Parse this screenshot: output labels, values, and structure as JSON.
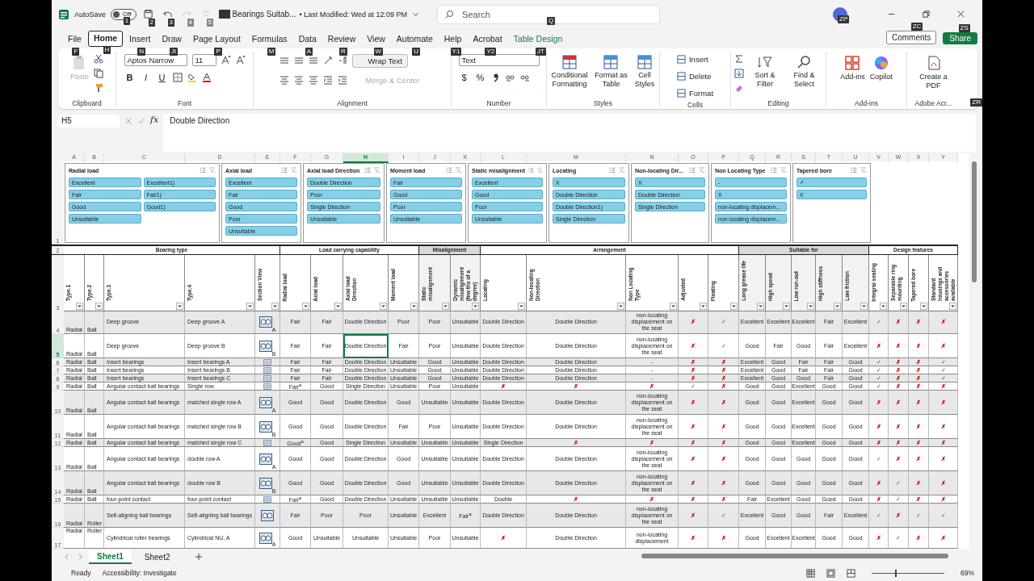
{
  "title_bar": {
    "autosave_label": "AutoSave",
    "autosave": {
      "on": false,
      "label": "Off",
      "keytip": "1"
    },
    "quick_access": [
      {
        "kind": "save",
        "keytip": "2",
        "disabled": false
      },
      {
        "kind": "undo",
        "keytip": "3",
        "disabled": false
      },
      {
        "kind": "redo",
        "keytip": "4",
        "disabled": true
      },
      {
        "kind": "customize",
        "keytip": "5",
        "disabled": true
      }
    ],
    "file_name": "Bearings Suitab...",
    "last_modified": "• Last Modified: Wed at 12:09 PM",
    "search_placeholder": "Search",
    "search_keytip": "Q",
    "avatar_keytip": "ZP"
  },
  "tabs": [
    {
      "label": "File",
      "keytip": "F",
      "selected": false,
      "contextual": false
    },
    {
      "label": "Home",
      "keytip": "H",
      "selected": true,
      "contextual": false
    },
    {
      "label": "Insert",
      "keytip": "N",
      "selected": false,
      "contextual": false
    },
    {
      "label": "Draw",
      "keytip": "JI",
      "selected": false,
      "contextual": false
    },
    {
      "label": "Page Layout",
      "keytip": "P",
      "selected": false,
      "contextual": false
    },
    {
      "label": "Formulas",
      "keytip": "M",
      "selected": false,
      "contextual": false
    },
    {
      "label": "Data",
      "keytip": "A",
      "selected": false,
      "contextual": false
    },
    {
      "label": "Review",
      "keytip": "R",
      "selected": false,
      "contextual": false
    },
    {
      "label": "View",
      "keytip": "W",
      "selected": false,
      "contextual": false
    },
    {
      "label": "Automate",
      "keytip": "U",
      "selected": false,
      "contextual": false
    },
    {
      "label": "Help",
      "keytip": "Y1",
      "selected": false,
      "contextual": false
    },
    {
      "label": "Acrobat",
      "keytip": "Y2",
      "selected": false,
      "contextual": false
    },
    {
      "label": "Table Design",
      "keytip": "JT",
      "selected": false,
      "contextual": true
    }
  ],
  "comments": {
    "label": "Comments",
    "keytip": "ZC"
  },
  "share": {
    "label": "Share",
    "keytip": "ZS"
  },
  "ribbon_keytip": "ZR",
  "ribbon": {
    "clipboard": {
      "label": "Clipboard",
      "paste": "Paste"
    },
    "font": {
      "label": "Font",
      "name": "Aptos Narrow",
      "size": "11",
      "bold": "B",
      "italic": "I",
      "underline": "U"
    },
    "alignment": {
      "label": "Alignment",
      "wrap_text": "Wrap Text",
      "merge": "Merge & Center"
    },
    "number": {
      "label": "Number",
      "format": "Text",
      "currency": "$",
      "percent": "%"
    },
    "styles": {
      "label": "Styles",
      "buttons": [
        "Conditional Formatting",
        "Format as Table",
        "Cell Styles"
      ]
    },
    "cells": {
      "label": "Cells",
      "buttons": [
        "Insert",
        "Delete",
        "Format"
      ]
    },
    "editing": {
      "label": "Editing",
      "buttons": [
        "Sort & Filter",
        "Find & Select"
      ]
    },
    "addins": {
      "label": "Add-ins",
      "buttons": [
        "Add-ins",
        "Copilot"
      ]
    },
    "acrobat": {
      "label": "Adobe Acr...",
      "buttons": [
        "Create a PDF"
      ]
    }
  },
  "formula_bar": {
    "name_box": "H5",
    "fx": "fx",
    "content": "Double Direction"
  },
  "columns": [
    {
      "letter": "A",
      "selected": false
    },
    {
      "letter": "B",
      "selected": false
    },
    {
      "letter": "C",
      "selected": false
    },
    {
      "letter": "D",
      "selected": false
    },
    {
      "letter": "E",
      "selected": false
    },
    {
      "letter": "F",
      "selected": false
    },
    {
      "letter": "G",
      "selected": false
    },
    {
      "letter": "H",
      "selected": true
    },
    {
      "letter": "I",
      "selected": false
    },
    {
      "letter": "J",
      "selected": false
    },
    {
      "letter": "K",
      "selected": false
    },
    {
      "letter": "L",
      "selected": false
    },
    {
      "letter": "M",
      "selected": false
    },
    {
      "letter": "N",
      "selected": false
    },
    {
      "letter": "O",
      "selected": false
    },
    {
      "letter": "P",
      "selected": false
    },
    {
      "letter": "Q",
      "selected": false
    },
    {
      "letter": "R",
      "selected": false
    },
    {
      "letter": "S",
      "selected": false
    },
    {
      "letter": "T",
      "selected": false
    },
    {
      "letter": "U",
      "selected": false
    },
    {
      "letter": "V",
      "selected": false
    },
    {
      "letter": "W",
      "selected": false
    },
    {
      "letter": "X",
      "selected": false
    },
    {
      "letter": "Y",
      "selected": false
    }
  ],
  "slicers": [
    {
      "title": "Radial load",
      "items": [
        {
          "label": "Excellent",
          "selected": true
        },
        {
          "label": "Excellent1)",
          "selected": true
        },
        {
          "label": "Fair",
          "selected": true
        },
        {
          "label": "Fair1)",
          "selected": true
        },
        {
          "label": "Good",
          "selected": true
        },
        {
          "label": "Good1)",
          "selected": true
        },
        {
          "label": "Unsuitable",
          "selected": true
        }
      ]
    },
    {
      "title": "Axial load",
      "items": [
        {
          "label": "Excellent",
          "selected": true
        },
        {
          "label": "Fair",
          "selected": true
        },
        {
          "label": "Good",
          "selected": true
        },
        {
          "label": "Poor",
          "selected": true
        },
        {
          "label": "Unsuitable",
          "selected": true
        }
      ]
    },
    {
      "title": "Axial load Direction",
      "items": [
        {
          "label": "Double Direction",
          "selected": true
        },
        {
          "label": "Poor",
          "selected": true
        },
        {
          "label": "Single Direction",
          "selected": true
        },
        {
          "label": "Unsuitable",
          "selected": true
        }
      ]
    },
    {
      "title": "Moment load",
      "items": [
        {
          "label": "Fair",
          "selected": true
        },
        {
          "label": "Good",
          "selected": true
        },
        {
          "label": "Poor",
          "selected": true
        },
        {
          "label": "Unsuitable",
          "selected": true
        }
      ]
    },
    {
      "title": "Static misalignment",
      "items": [
        {
          "label": "Excellent",
          "selected": true
        },
        {
          "label": "Good",
          "selected": true
        },
        {
          "label": "Poor",
          "selected": true
        },
        {
          "label": "Unsuitable",
          "selected": true
        }
      ]
    },
    {
      "title": "Locating",
      "items": [
        {
          "label": "X",
          "selected": true
        },
        {
          "label": "Double Direction",
          "selected": true
        },
        {
          "label": "Double Direction1)",
          "selected": true
        },
        {
          "label": "Single Direction",
          "selected": true
        }
      ]
    },
    {
      "title": "Non-locating Dir...",
      "items": [
        {
          "label": "X",
          "selected": true
        },
        {
          "label": "Double Direction",
          "selected": true
        },
        {
          "label": "Single Direction",
          "selected": true
        }
      ]
    },
    {
      "title": "Non Locating Type",
      "items": [
        {
          "label": "-",
          "selected": true
        },
        {
          "label": "X",
          "selected": true
        },
        {
          "label": "non-locating displacem...",
          "selected": true
        },
        {
          "label": "non-locating displacem...",
          "selected": true
        }
      ]
    },
    {
      "title": "Tapered bore",
      "items": [
        {
          "label": "✓",
          "selected": true
        },
        {
          "label": "X",
          "selected": true
        }
      ]
    }
  ],
  "groups": [
    {
      "label": "Bearing type",
      "shaded": false
    },
    {
      "label": "Load carrying capability",
      "shaded": false
    },
    {
      "label": "Misalignment",
      "shaded": true
    },
    {
      "label": "Arrangement",
      "shaded": false
    },
    {
      "label": "Suitable for",
      "shaded": true
    },
    {
      "label": "Design features",
      "shaded": false
    }
  ],
  "headers": [
    "Type.1",
    "Type.2",
    "Type.3",
    "Type.4",
    "Section View",
    "Radial load",
    "Axial load",
    "Axial load Direction",
    "Moment load",
    "Static misalignment",
    "Dynamic misalignment (few ths of a degree)",
    "Locating",
    "Non-locating Direction",
    "Non Locating Type",
    "Adjusted",
    "Floating",
    "Long grease life",
    "High speed",
    "Low run-out",
    "High stiffness",
    "Low friction",
    "Integral sealing",
    "Separable ring mounting",
    "Tapered bore",
    "Standard housings and accessories available"
  ],
  "rows": [
    {
      "num": "4",
      "selected": false,
      "cells": [
        "Radial",
        "Ball",
        "Deep groove",
        "Deep groove A",
        {
          "kind": "figure",
          "letter": "A"
        },
        "Fair",
        "Fair",
        "Double Direction",
        "Poor",
        "Poor",
        "Unsuitable",
        "Double Direction",
        "Double Direction",
        "non-locating displacement on the seat",
        {
          "text": "✗",
          "kind": "cross"
        },
        {
          "text": "✓",
          "kind": "tick"
        },
        "Excellent",
        "Excellent",
        "Excellent",
        "Fair",
        "Excellent",
        {
          "text": "✓",
          "kind": "tick"
        },
        {
          "text": "✗",
          "kind": "cross"
        },
        {
          "text": "✗",
          "kind": "cross"
        },
        {
          "text": "✗",
          "kind": "cross"
        }
      ]
    },
    {
      "num": "5",
      "selected": true,
      "cells": [
        "Radial",
        "Ball",
        "Deep groove",
        "Deep groove B",
        {
          "kind": "figure",
          "letter": "B"
        },
        "Fair",
        "Fair",
        "Double Direction",
        "Fair",
        "Poor",
        "Unsuitable",
        "Double Direction",
        "Double Direction",
        "non-locating displacement on the seat",
        {
          "text": "✗",
          "kind": "cross"
        },
        {
          "text": "✓",
          "kind": "tick"
        },
        "Good",
        "Fair",
        "Good",
        "Fair",
        "Excellent",
        {
          "text": "✗",
          "kind": "cross"
        },
        {
          "text": "✗",
          "kind": "cross"
        },
        {
          "text": "✗",
          "kind": "cross"
        },
        {
          "text": "✗",
          "kind": "cross"
        }
      ]
    },
    {
      "num": "6",
      "selected": false,
      "cells": [
        "Radial",
        "Ball",
        "Insert bearings",
        "Insert bearings A",
        {
          "kind": "figure"
        },
        "Fair",
        "Fair",
        "Double Direction",
        "Unsuitable",
        "Good",
        "Unsuitable",
        "Double Direction",
        "Double Direction",
        "-",
        {
          "text": "✗",
          "kind": "cross"
        },
        {
          "text": "✗",
          "kind": "cross"
        },
        "Excellent",
        "Good",
        "Fair",
        "Fair",
        "Good",
        {
          "text": "✓",
          "kind": "tick"
        },
        {
          "text": "✗",
          "kind": "cross"
        },
        {
          "text": "✗",
          "kind": "cross"
        },
        {
          "text": "✓",
          "kind": "tick"
        }
      ]
    },
    {
      "num": "7",
      "selected": false,
      "cells": [
        "Radial",
        "Ball",
        "Insert bearings",
        "Insert bearings B",
        {
          "kind": "figure"
        },
        "Fair",
        "Fair",
        "Double Direction",
        "Unsuitable",
        "Good",
        "Unsuitable",
        "Double Direction",
        "Double Direction",
        "-",
        {
          "text": "✗",
          "kind": "cross"
        },
        {
          "text": "✗",
          "kind": "cross"
        },
        "Excellent",
        "Good",
        "Fair",
        "Fair",
        "Good",
        {
          "text": "✓",
          "kind": "tick"
        },
        {
          "text": "✗",
          "kind": "cross"
        },
        {
          "text": "✗",
          "kind": "cross"
        },
        {
          "text": "✓",
          "kind": "tick"
        }
      ]
    },
    {
      "num": "8",
      "selected": false,
      "cells": [
        "Radial",
        "Ball",
        "Insert bearings",
        "Insert bearings C",
        {
          "kind": "figure"
        },
        "Fair",
        "Fair",
        "Double Direction",
        "Unsuitable",
        "Good",
        "Unsuitable",
        "Double Direction",
        "Double Direction",
        "-",
        {
          "text": "✗",
          "kind": "cross"
        },
        {
          "text": "✗",
          "kind": "cross"
        },
        "Excellent",
        "Good",
        "Good",
        "Fair",
        "Good",
        {
          "text": "✓",
          "kind": "tick"
        },
        {
          "text": "✗",
          "kind": "cross"
        },
        {
          "text": "✗",
          "kind": "cross"
        },
        {
          "text": "✓",
          "kind": "tick"
        }
      ]
    },
    {
      "num": "9",
      "selected": false,
      "cells": [
        "Radial",
        "Ball",
        "Angular contact ball bearings",
        "Single row",
        {
          "kind": "figure"
        },
        "Fair$^{a}$",
        "Good",
        "Single Direction",
        "Unsuitable",
        "Poor",
        "Unsuitable",
        {
          "text": "✗",
          "kind": "cross"
        },
        {
          "text": "✗",
          "kind": "cross"
        },
        {
          "text": "✗",
          "kind": "cross"
        },
        {
          "text": "✓",
          "kind": "tick"
        },
        {
          "text": "✗",
          "kind": "cross"
        },
        "Good",
        "Good",
        "Excellent",
        "Good",
        "Good",
        {
          "text": "✓",
          "kind": "tick"
        },
        {
          "text": "✗",
          "kind": "cross"
        },
        {
          "text": "✗",
          "kind": "cross"
        },
        {
          "text": "✗",
          "kind": "cross"
        }
      ]
    },
    {
      "num": "10",
      "selected": false,
      "cells": [
        "Radial",
        "Ball",
        "Angular contact ball bearings",
        "matched single row A",
        {
          "kind": "figure",
          "letter": "A"
        },
        "Good",
        "Good",
        "Double Direction",
        "Good",
        "Unsuitable",
        "Unsuitable",
        "Double Direction",
        "Double Direction",
        "non-locating displacement on the seat",
        {
          "text": "✗",
          "kind": "cross"
        },
        {
          "text": "✗",
          "kind": "cross"
        },
        "Good",
        "Good",
        "Excellent",
        "Good",
        "Good",
        {
          "text": "✗",
          "kind": "cross"
        },
        {
          "text": "✗",
          "kind": "cross"
        },
        {
          "text": "✗",
          "kind": "cross"
        },
        {
          "text": "✗",
          "kind": "cross"
        }
      ]
    },
    {
      "num": "11",
      "selected": false,
      "cells": [
        "Radial",
        "Ball",
        "Angular contact ball bearings",
        "matched single row B",
        {
          "kind": "figure",
          "letter": "B"
        },
        "Good",
        "Good",
        "Double Direction",
        "Fair",
        "Poor",
        "Unsuitable",
        "Double Direction",
        "Double Direction",
        "non-locating displacement on the seat",
        {
          "text": "✗",
          "kind": "cross"
        },
        {
          "text": "✗",
          "kind": "cross"
        },
        "Good",
        "Good",
        "Excellent",
        "Good",
        "Good",
        {
          "text": "✗",
          "kind": "cross"
        },
        {
          "text": "✗",
          "kind": "cross"
        },
        {
          "text": "✗",
          "kind": "cross"
        },
        {
          "text": "✗",
          "kind": "cross"
        }
      ]
    },
    {
      "num": "12",
      "selected": false,
      "cells": [
        "Radial",
        "Ball",
        "Angular contact ball bearings",
        "matched single row C",
        {
          "kind": "figure"
        },
        "Good$^{a}$",
        "Good",
        "Single Direction",
        "Unsuitable",
        "Unsuitable",
        "Unsuitable",
        "Single Direction",
        {
          "text": "✗",
          "kind": "cross"
        },
        {
          "text": "✗",
          "kind": "cross"
        },
        {
          "text": "✗",
          "kind": "cross"
        },
        {
          "text": "✗",
          "kind": "cross"
        },
        "Good",
        "Good",
        "Excellent",
        "Good",
        "Good",
        {
          "text": "✗",
          "kind": "cross"
        },
        {
          "text": "✗",
          "kind": "cross"
        },
        {
          "text": "✗",
          "kind": "cross"
        },
        {
          "text": "✗",
          "kind": "cross"
        }
      ]
    },
    {
      "num": "13",
      "selected": false,
      "cells": [
        "Radial",
        "Ball",
        "Angular contact ball bearings",
        "double row A",
        {
          "kind": "figure",
          "letter": "A"
        },
        "Good",
        "Good",
        "Double Direction",
        "Good",
        "Unsuitable",
        "Unsuitable",
        "Double Direction",
        "Double Direction",
        "non-locating displacement on the seat",
        {
          "text": "✗",
          "kind": "cross"
        },
        {
          "text": "✗",
          "kind": "cross"
        },
        "Good",
        "Good",
        "Good",
        "Good",
        "Good",
        {
          "text": "✓",
          "kind": "tick"
        },
        {
          "text": "✗",
          "kind": "cross"
        },
        {
          "text": "✗",
          "kind": "cross"
        },
        {
          "text": "✗",
          "kind": "cross"
        }
      ]
    },
    {
      "num": "14",
      "selected": false,
      "cells": [
        "Radial",
        "Ball",
        "Angular contact ball bearings",
        "double row B",
        {
          "kind": "figure",
          "letter": "B"
        },
        "Good",
        "Good",
        "Double Direction",
        "Good",
        "Unsuitable",
        "Unsuitable",
        "Double Direction",
        "Double Direction",
        "non-locating displacement on the seat",
        {
          "text": "✗",
          "kind": "cross"
        },
        {
          "text": "✗",
          "kind": "cross"
        },
        "Good",
        "Good",
        "Good",
        "Good",
        "Good",
        {
          "text": "✗",
          "kind": "cross"
        },
        {
          "text": "✓",
          "kind": "tick"
        },
        {
          "text": "✗",
          "kind": "cross"
        },
        {
          "text": "✗",
          "kind": "cross"
        }
      ]
    },
    {
      "num": "15",
      "selected": false,
      "cells": [
        "Radial",
        "Ball",
        "four-point contact",
        "four-point contact",
        {
          "kind": "figure"
        },
        "Fair$^{a}$",
        "Good",
        "Double Direction",
        "Unsuitable",
        "Unsuitable",
        "Unsuitable",
        "Double",
        {
          "text": "✗",
          "kind": "cross"
        },
        {
          "text": "✗",
          "kind": "cross"
        },
        {
          "text": "✗",
          "kind": "cross"
        },
        {
          "text": "✗",
          "kind": "cross"
        },
        "Fair",
        "Excellent",
        "Good",
        "Good",
        "Good",
        {
          "text": "✗",
          "kind": "cross"
        },
        {
          "text": "✓",
          "kind": "tick"
        },
        {
          "text": "✗",
          "kind": "cross"
        },
        {
          "text": "✗",
          "kind": "cross"
        }
      ]
    },
    {
      "num": "16",
      "selected": false,
      "cells": [
        "Radial",
        "Roller",
        "Self-aligning ball bearings",
        "Self-aligning ball bearings",
        {
          "kind": "figure"
        },
        "Fair",
        "Poor",
        "Poor",
        "Unsuitable",
        "Excellent",
        "Fair$^{a}$",
        "Double Direction",
        "Double Direction",
        "non-locating displacement on the seat",
        {
          "text": "✗",
          "kind": "cross"
        },
        {
          "text": "✓",
          "kind": "tick"
        },
        "Excellent",
        "Good",
        "Good",
        "Fair",
        "Excellent",
        {
          "text": "✓",
          "kind": "tick"
        },
        {
          "text": "✗",
          "kind": "cross"
        },
        {
          "text": "✓",
          "kind": "tick"
        },
        {
          "text": "✓",
          "kind": "tick"
        }
      ]
    },
    {
      "num": "17",
      "selected": false,
      "cells": [
        "Radial",
        "Roller",
        "Cylindrical roller bearings",
        "Cylindrical NU, A",
        {
          "kind": "figure",
          "letter": "A"
        },
        "Good",
        "Unsuitable",
        "Unsuitable",
        "Unsuitable",
        "Poor",
        "Unsuitable",
        {
          "text": "✗",
          "kind": "cross"
        },
        "Double Direction",
        "non-locating displacement",
        {
          "text": "✗",
          "kind": "cross"
        },
        {
          "text": "✗",
          "kind": "cross"
        },
        "Good",
        "Excellent",
        "Excellent",
        "Good",
        "Good",
        {
          "text": "✗",
          "kind": "cross"
        },
        {
          "text": "✓",
          "kind": "tick"
        },
        {
          "text": "✗",
          "kind": "cross"
        },
        {
          "text": "✗",
          "kind": "cross"
        }
      ]
    }
  ],
  "header_row_numbers": [
    "1",
    "2",
    "3"
  ],
  "sheet_tabs": [
    {
      "label": "Sheet1",
      "selected": true
    },
    {
      "label": "Sheet2",
      "selected": false
    }
  ],
  "status": {
    "ready": "Ready",
    "accessibility": "Accessibility: Investigate",
    "zoom": "69%",
    "zoom_slider": {
      "level": 0.32
    }
  }
}
